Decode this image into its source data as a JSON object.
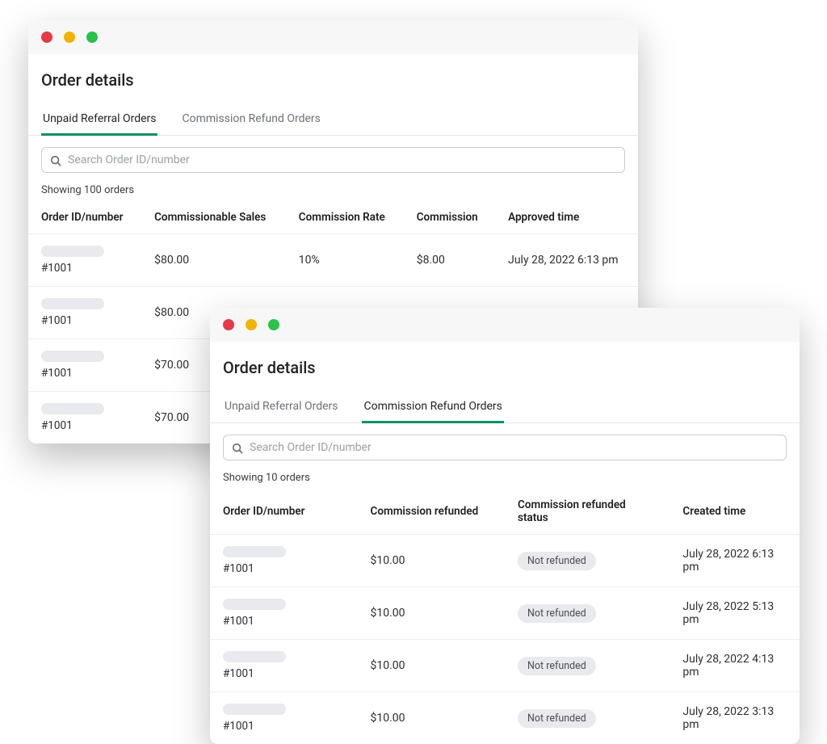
{
  "win1": {
    "title": "Order details",
    "tabs": {
      "unpaid": "Unpaid Referral Orders",
      "refund": "Commission Refund Orders"
    },
    "search_placeholder": "Search Order ID/number",
    "showing": "Showing 100 orders",
    "headers": {
      "id": "Order ID/number",
      "sales": "Commissionable Sales",
      "rate": "Commission Rate",
      "comm": "Commission",
      "time": "Approved time"
    },
    "rows": [
      {
        "id": "#1001",
        "sales": "$80.00",
        "rate": "10%",
        "comm": "$8.00",
        "time": "July 28, 2022 6:13 pm"
      },
      {
        "id": "#1001",
        "sales": "$80.00",
        "rate": "",
        "comm": "",
        "time": ""
      },
      {
        "id": "#1001",
        "sales": "$70.00",
        "rate": "",
        "comm": "",
        "time": ""
      },
      {
        "id": "#1001",
        "sales": "$70.00",
        "rate": "",
        "comm": "",
        "time": ""
      }
    ]
  },
  "win2": {
    "title": "Order details",
    "tabs": {
      "unpaid": "Unpaid Referral Orders",
      "refund": "Commission Refund Orders"
    },
    "search_placeholder": "Search Order ID/number",
    "showing": "Showing 10 orders",
    "headers": {
      "id": "Order ID/number",
      "refunded": "Commission refunded",
      "status": "Commission refunded status",
      "time": "Created time"
    },
    "status_label": "Not refunded",
    "rows": [
      {
        "id": "#1001",
        "refunded": "$10.00",
        "time": "July 28, 2022 6:13 pm"
      },
      {
        "id": "#1001",
        "refunded": "$10.00",
        "time": "July 28, 2022 5:13 pm"
      },
      {
        "id": "#1001",
        "refunded": "$10.00",
        "time": "July 28, 2022 4:13 pm"
      },
      {
        "id": "#1001",
        "refunded": "$10.00",
        "time": "July 28, 2022 3:13 pm"
      }
    ]
  }
}
